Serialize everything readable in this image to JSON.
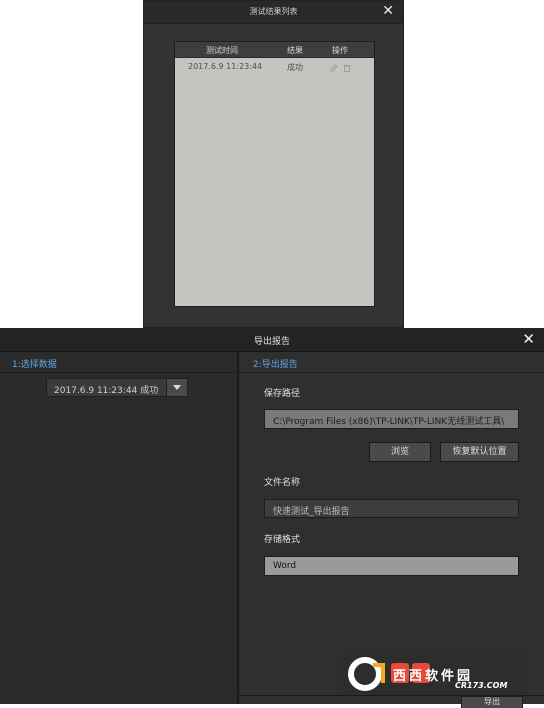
{
  "results_dialog": {
    "title": "测试结果列表",
    "close_label": "✕",
    "columns": {
      "time": "测试时间",
      "result": "结果",
      "actions": "操作"
    },
    "rows": [
      {
        "time": "2017.6.9 11:23:44",
        "result": "成功"
      }
    ],
    "icons": [
      "edit-icon",
      "delete-icon"
    ]
  },
  "export_dialog": {
    "title": "导出报告",
    "close_label": "✕",
    "step1_label": "1:选择数据",
    "step2_label": "2:导出报告",
    "data_select_value": "2017.6.9 11:23:44 成功",
    "save_path_label": "保存路径",
    "save_path_value": "C:\\Program Files (x86)\\TP-LINK\\TP-LINK无线测试工具\\",
    "browse_label": "浏览",
    "restore_default_label": "恢复默认位置",
    "file_name_label": "文件名称",
    "file_name_value": "快速测试_导出报告",
    "format_label": "存储格式",
    "format_value": "Word",
    "export_button_label": "导出"
  },
  "watermark": {
    "brand": "西西软件园",
    "url": "CR173.COM"
  },
  "colors": {
    "accent_blue": "#5aa6e6",
    "dialog_bg": "#2b2b2b",
    "table_bg": "#c4c4c0"
  }
}
